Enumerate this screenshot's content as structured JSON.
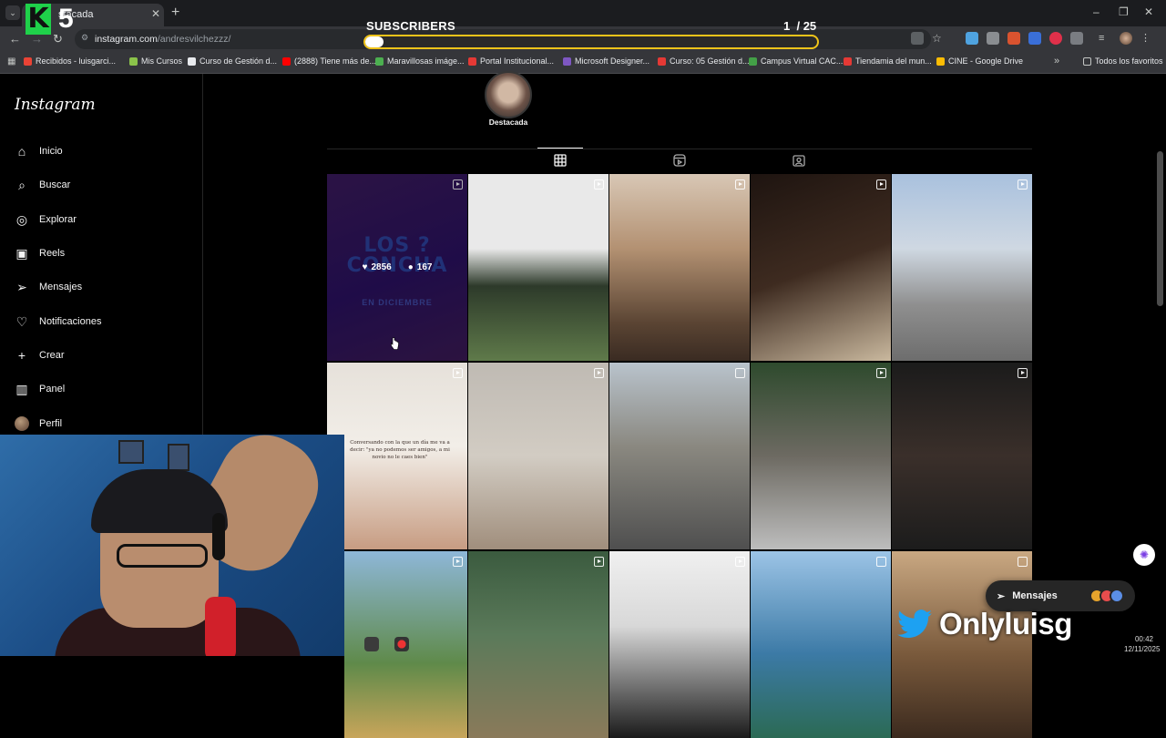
{
  "browser": {
    "tab_title": "stacada",
    "url_host": "instagram.com",
    "url_path": "/andresvilchezzz/",
    "window_controls": [
      "–",
      "❐",
      "✕"
    ],
    "bookmarks": [
      {
        "label": "Recibidos - luisgarci...",
        "color": "#ea4335"
      },
      {
        "label": "Mis Cursos",
        "color": "#8bc34a"
      },
      {
        "label": "Curso de Gestión d...",
        "color": "#e8eaed"
      },
      {
        "label": "(2888) Tiene más de...",
        "color": "#ff0000"
      },
      {
        "label": "Maravillosas imáge...",
        "color": "#4caf50"
      },
      {
        "label": "Portal Institucional...",
        "color": "#e53935"
      },
      {
        "label": "Microsoft Designer...",
        "color": "#7e57c2"
      },
      {
        "label": "Curso: 05 Gestión d...",
        "color": "#e53935"
      },
      {
        "label": "Campus Virtual CAC...",
        "color": "#43a047"
      },
      {
        "label": "Tiendamia del mun...",
        "color": "#e53935"
      },
      {
        "label": "CINE - Google Drive",
        "color": "#fbbc04"
      }
    ],
    "bookmarks_overflow": "»",
    "all_favorites": "Todos los favoritos"
  },
  "overlay": {
    "label": "SUBSCRIBERS",
    "count": "1",
    "goal": "/ 25",
    "progress": 0.04,
    "brand_number": "5",
    "brand_letter": "K"
  },
  "sidebar": {
    "logo": "Instagram",
    "items": [
      {
        "label": "Inicio",
        "icon": "home-icon"
      },
      {
        "label": "Buscar",
        "icon": "search-icon"
      },
      {
        "label": "Explorar",
        "icon": "compass-icon"
      },
      {
        "label": "Reels",
        "icon": "reels-icon"
      },
      {
        "label": "Mensajes",
        "icon": "messenger-icon"
      },
      {
        "label": "Notificaciones",
        "icon": "heart-icon"
      },
      {
        "label": "Crear",
        "icon": "plus-icon"
      },
      {
        "label": "Panel",
        "icon": "dashboard-icon"
      },
      {
        "label": "Perfil",
        "icon": "avatar"
      }
    ]
  },
  "profile": {
    "highlight_label": "Destacada",
    "tabs": [
      "grid-icon",
      "reels-tab-icon",
      "tagged-icon"
    ],
    "hovered_post": {
      "likes": "2856",
      "comments": "167"
    },
    "post_caption": "Conversando con la que un día me va a decir: \"ya no podemos ser amigos, a mi novio no le caes bien\"",
    "post_title_art": "LOS ? CONCHA",
    "post_subtitle_art": "EN DICIEMBRE"
  },
  "posts": [
    {
      "type": "reel",
      "bg": "linear-gradient(160deg,#3a1a5c,#2a1160 55%,#3b1a55)"
    },
    {
      "type": "reel",
      "bg": "linear-gradient(180deg,#e9e9e9 0 40%,#2d3a2a 60%,#5f7a4a 100%)"
    },
    {
      "type": "reel",
      "bg": "linear-gradient(180deg,#d8c7b5 0%,#b39172 40%,#5a4433 80%,#3a2b22 100%)"
    },
    {
      "type": "reel",
      "bg": "linear-gradient(160deg,#1e1410,#3e2b20 50%,#c9b89e 100%)"
    },
    {
      "type": "reel",
      "bg": "linear-gradient(180deg,#a9c1de 0%,#cfd8e2 40%,#8f8f8f 70%,#6d6d6d 100%)"
    },
    {
      "type": "reel",
      "bg": "linear-gradient(180deg,#e6e1da 0%,#f2eee8 45%,#c79c82 100%)"
    },
    {
      "type": "reel",
      "bg": "linear-gradient(180deg,#bfbab3 0%,#d2ccc3 50%,#a08e7c 100%)"
    },
    {
      "type": "post",
      "bg": "linear-gradient(180deg,#b9c3cc 0%,#8a8880 45%,#4f4f4f 100%)"
    },
    {
      "type": "reel",
      "bg": "linear-gradient(180deg,#2e4a2d 0%,#6d6a62 50%,#bdbdbd 100%)"
    },
    {
      "type": "reel",
      "bg": "linear-gradient(180deg,#1b1b1b 0%,#3a2f2a 50%,#1c1c1c 100%)"
    },
    {
      "type": "reel",
      "bg": "linear-gradient(180deg,#8eb7d8 0%,#5f8a4a 60%,#c8a55a 100%)"
    },
    {
      "type": "reel",
      "bg": "linear-gradient(180deg,#3b5b3f 0%,#5b7a5a 45%,#8a7a5a 100%)"
    },
    {
      "type": "reel",
      "bg": "linear-gradient(180deg,#f0f0f0 0%,#d8d8d8 40%,#1a1a1a 100%)"
    },
    {
      "type": "post",
      "bg": "linear-gradient(180deg,#9cc4e6 0%,#3c7aa6 55%,#2b6a54 100%)"
    },
    {
      "type": "post",
      "bg": "linear-gradient(180deg,#c9a882 0%,#7a5a3c 55%,#3b2a1e 100%)"
    }
  ],
  "messages_pill": {
    "label": "Mensajes"
  },
  "stream": {
    "twitter_handle": "Onlyluisg"
  },
  "clock": {
    "time": "00:42",
    "date": "12/11/2025"
  }
}
